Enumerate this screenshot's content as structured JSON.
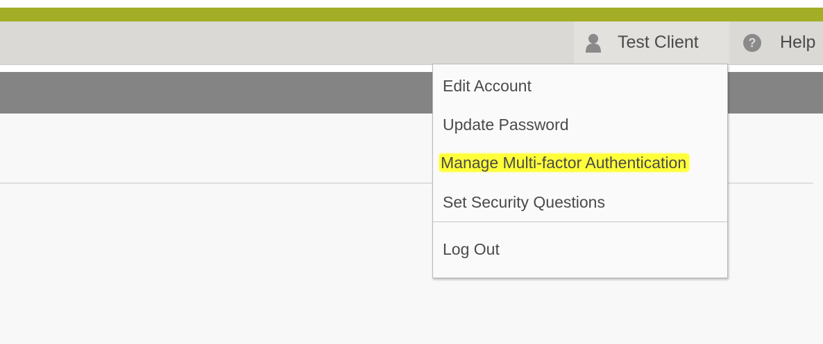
{
  "colors": {
    "accent": "#a3ad26",
    "header_bg": "#dbd9d6",
    "band_bg": "#848484",
    "highlight": "#ffff3a",
    "text": "#4a4a4a"
  },
  "header": {
    "user": {
      "icon": "user-icon",
      "name": "Test Client"
    },
    "help": {
      "icon": "help-circle-icon",
      "label": "Help"
    }
  },
  "user_menu": {
    "items": [
      {
        "label": "Edit Account"
      },
      {
        "label": "Update Password"
      },
      {
        "label": "Manage Multi-factor Authentication",
        "highlighted": true
      },
      {
        "label": "Set Security Questions"
      },
      {
        "label": "Log Out"
      }
    ]
  }
}
